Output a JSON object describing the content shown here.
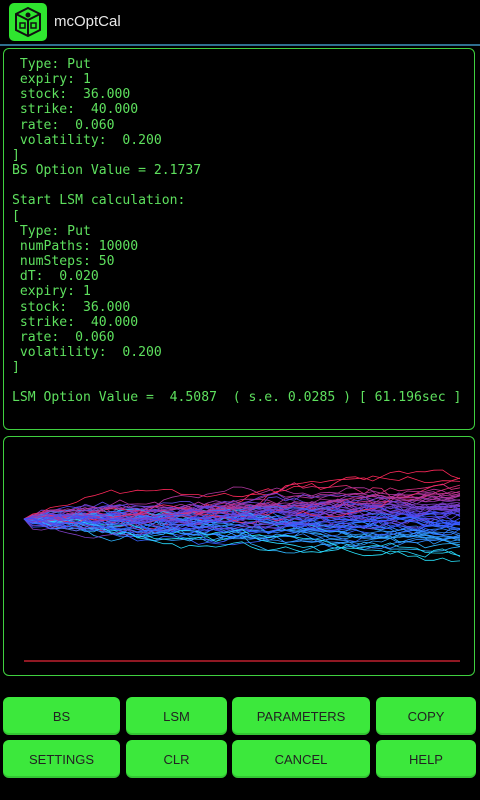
{
  "app": {
    "title": "mcOptCal"
  },
  "log": {
    "lines": [
      " Type: Put",
      " expiry: 1",
      " stock:  36.000",
      " strike:  40.000",
      " rate:  0.060",
      " volatility:  0.200",
      "]",
      "BS Option Value = 2.1737",
      "",
      "Start LSM calculation:",
      "[",
      " Type: Put",
      " numPaths: 10000",
      " numSteps: 50",
      " dT:  0.020",
      " expiry: 1",
      " stock:  36.000",
      " strike:  40.000",
      " rate:  0.060",
      " volatility:  0.200",
      "]",
      "",
      "LSM Option Value =  4.5087  ( s.e. 0.0285 ) [ 61.196sec ]"
    ]
  },
  "simulation": {
    "type": "line",
    "description_free": true,
    "start_value": 36,
    "strike": 40,
    "steps": 50,
    "volatility": 0.2,
    "rate": 0.06,
    "colors": {
      "high": "#ff1f4f",
      "mid": "#3a4bff",
      "low": "#2fe8ff",
      "axis": "#c0202f"
    }
  },
  "buttons": {
    "bs": "BS",
    "lsm": "LSM",
    "parameters": "PARAMETERS",
    "copy": "COPY",
    "settings": "SETTINGS",
    "clr": "CLR",
    "cancel": "CANCEL",
    "help": "HELP"
  },
  "theme": {
    "accent": "#3ce83c",
    "text": "#5ee05e"
  }
}
